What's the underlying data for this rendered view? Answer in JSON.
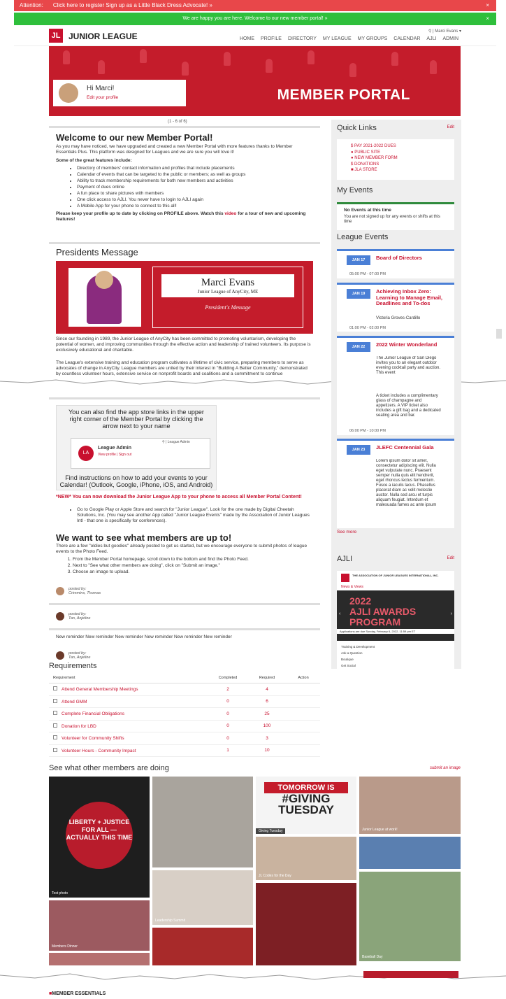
{
  "alerts": {
    "attention": "Attention:",
    "attention_text": "Click here to register Sign up as a Little Black Dress Advocate! »",
    "welcome": "We are happy you are here. Welcome to our new member portal! »",
    "close": "×"
  },
  "header": {
    "logo": "JL",
    "brand": "JUNIOR LEAGUE",
    "user": "Marci Evans",
    "nav": [
      "HOME",
      "PROFILE",
      "DIRECTORY",
      "MY LEAGUE",
      "MY GROUPS",
      "CALENDAR",
      "AJLI",
      "ADMIN"
    ]
  },
  "hero": {
    "title": "MEMBER PORTAL",
    "greeting": "Hi Marci!",
    "edit": "Edit your profile"
  },
  "counter": "(1 - 6 of 6)",
  "welcome": {
    "title": "Welcome to our new Member Portal!",
    "intro": "As you may have noticed, we have upgraded and created a new Member Portal with more features thanks to Member Essentials Plus. This platform was designed for Leagues and we are sure you will love it!",
    "features_head": "Some of the great features include:",
    "features": [
      "Directory of members' contact information and profiles that include placements",
      "Calendar of events that can be targeted to the public or members; as well as groups",
      "Ability to track membership requirements for both new members and activities",
      "Payment of dues online",
      "A fun place to share pictures with members",
      "One click access to AJLI. You never have to login to AJLI again",
      "A Mobile App for your phone to connect to this all!"
    ],
    "footer": "Please keep your profile up to date by clicking on PROFILE above. Watch this",
    "video": "video",
    "footer2": "for a tour of new and upcoming features!"
  },
  "presidents": {
    "title": "Presidents Message",
    "name": "Marci Evans",
    "org": "Junior League of AnyCity, ME",
    "sub": "President's Message",
    "p1": "Since our founding in 1989, the Junior League of AnyCity has been committed to promoting voluntarism, developing the potential of women, and improving communities through the effective action and leadership of trained volunteers. Its purpose is exclusively educational and charitable.",
    "p2": "The League's extensive training and education program cultivates a lifetime of civic service, preparing members to serve as advocates of change in AnyCity. League members are united by their interest in \"Building A Better Community,\" demonstrated by countless volunteer hours, extensive service on nonprofit boards and coalitions and a commitment to continue"
  },
  "app": {
    "pic1": "You can also find the app store links in the upper right corner of the Member Portal by clicking the arrow next to your name",
    "la": "LA",
    "la_name": "League Admin",
    "la_links": "View profile | Sign out",
    "la_search": "League Admin",
    "pic2": "Find instructions on how to add your events to your Calendar! (Outlook, Google, iPhone, iOS, and Android)",
    "new": "*NEW* You can now download the Junior League App to your phone to access all Member Portal Content!",
    "bullet": "Go to Google Play or Apple Store and search for \"Junior League\". Look for the one made by Digital Cheetah Solutions, Inc. (You may see another App called \"Junior League Events\" made by the Association of Junior Leagues Intl - that one is specifically for conferences).",
    "see_title": "We want to see what members are up to!",
    "see_p": "There are a few \"oldies but goodies\" already posted to get us started, but we encourage everyone to submit photos of league events to the Photo Feed.",
    "steps": [
      "From the Member Portal homepage, scroll down to the bottom and find the Photo Feed.",
      "Next to \"See what other members are doing\", click on \"Submit an image.\"",
      "Choose an image to upload."
    ],
    "posted": "posted by:",
    "by1": "Crimmins, Thomas",
    "by2": "Tan, Anjeline",
    "reminder": "New reminder New reminder New reminder New reminder New reminder New reminder",
    "by3": "Tan, Anjeline"
  },
  "sidebar": {
    "quick": "Quick Links",
    "edit": "Edit",
    "links": [
      "PAY 2021-2022 DUES",
      "PUBLIC SITE",
      "NEW MEMBER FORM",
      "DONATIONS",
      "JLA STORE"
    ],
    "my_events": "My Events",
    "no_events": "No Events at this time",
    "no_events_p": "You are not signed up for any events or shifts at this time",
    "league_events": "League Events",
    "events": [
      {
        "date": "JAN 17",
        "title": "Board of Directors",
        "time": "05:00 PM - 07:00 PM"
      },
      {
        "date": "JAN 19",
        "title": "Achieving Inbox Zero: Learning to Manage Email, Deadlines and To-dos",
        "sub": "Victoria Groves-Cardillo",
        "time": "01:00 PM - 02:00 PM"
      },
      {
        "date": "JAN 22",
        "title": "2022 Winter Wonderland",
        "desc": "The Junior League of San Diego invites you to an elegant outdoor evening cocktail party and auction. This event",
        "desc2": "A ticket includes a complimentary glass of champagne and appetizers. A VIP ticket also includes a gift bag and a dedicated seating area and bar.",
        "time": "06:00 PM - 10:00 PM"
      },
      {
        "date": "JAN 23",
        "title": "JLEFC Centennial Gala",
        "desc": "Lorem ipsum dolor sit amet, consectetur adipiscing elit. Nulla eget vulputate nunc. Praesent semper nulla quis elit hendrerit, eget rhoncus lectus fermentum. Fusce a iaculis lacus. Phasellus placerat diam ac velit molestie auctor. Nulla sed arcu et turpis aliquam feugiat. Interdum et malesuada fames ac ante ipsum"
      }
    ],
    "see_more": "See more",
    "ajli": "AJLI",
    "ajli_org": "THE ASSOCIATION OF JUNIOR LEAGUES INTERNATIONAL, INC.",
    "news": "News & Views",
    "award1": "2022",
    "award2": "AJLI AWARDS",
    "award3": "PROGRAM",
    "award_sub": "Applications are due Sunday, February 6, 2022, 11:59 pm ET",
    "ajli_links": [
      "Training & Development",
      "Ask a Question",
      "Boutique",
      "Get Social"
    ]
  },
  "requirements": {
    "title": "Requirements",
    "headers": [
      "Requirement",
      "Completed",
      "Required",
      "Action"
    ],
    "rows": [
      {
        "name": "Attend General Membership Meetings",
        "done": "2",
        "req": "4"
      },
      {
        "name": "Attend GMM",
        "done": "0",
        "req": "6"
      },
      {
        "name": "Complete Financial Obligations",
        "done": "0",
        "req": "25"
      },
      {
        "name": "Donation for LBD",
        "done": "0",
        "req": "100"
      },
      {
        "name": "Volunteer for Community Shifts",
        "done": "0",
        "req": "3"
      },
      {
        "name": "Volunteer Hours - Community Impact",
        "done": "1",
        "req": "10"
      }
    ]
  },
  "gallery": {
    "title": "See what other members are doing",
    "submit": "submit an image",
    "captions": [
      "Test photo",
      "Members Dinner",
      "Giving Tuesday",
      "JL Codes for the Day",
      "Junior League at work!",
      "Leadership Summit",
      "Baseball Day"
    ],
    "liberty": "LIBERTY + JUSTICE FOR ALL — ACTUALLY THIS TIME",
    "giving1": "TOMORROW IS",
    "giving2": "#GIVING",
    "giving3": "TUESDAY"
  },
  "footer": "MEMBER ESSENTIALS"
}
